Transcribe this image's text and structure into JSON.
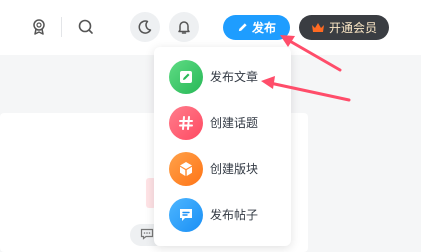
{
  "colors": {
    "primary": "#1e9dff",
    "vip_bg": "#3a3d42",
    "vip_text": "#fbe7c6",
    "crown": "#ff6a22",
    "arrow": "#ff4d6a"
  },
  "header": {
    "icons": [
      "award-icon",
      "search-icon",
      "moon-icon",
      "bell-icon"
    ],
    "publish_label": "发布",
    "vip_label": "开通会员"
  },
  "dropdown": {
    "items": [
      {
        "label": "发布文章",
        "icon": "edit-icon",
        "color": "#3ec96a"
      },
      {
        "label": "创建话题",
        "icon": "hashtag-icon",
        "color": "#ff5a6e"
      },
      {
        "label": "创建版块",
        "icon": "cube-icon",
        "color": "#ff8a2a"
      },
      {
        "label": "发布帖子",
        "icon": "chat-icon",
        "color": "#2aa3ff"
      }
    ]
  }
}
